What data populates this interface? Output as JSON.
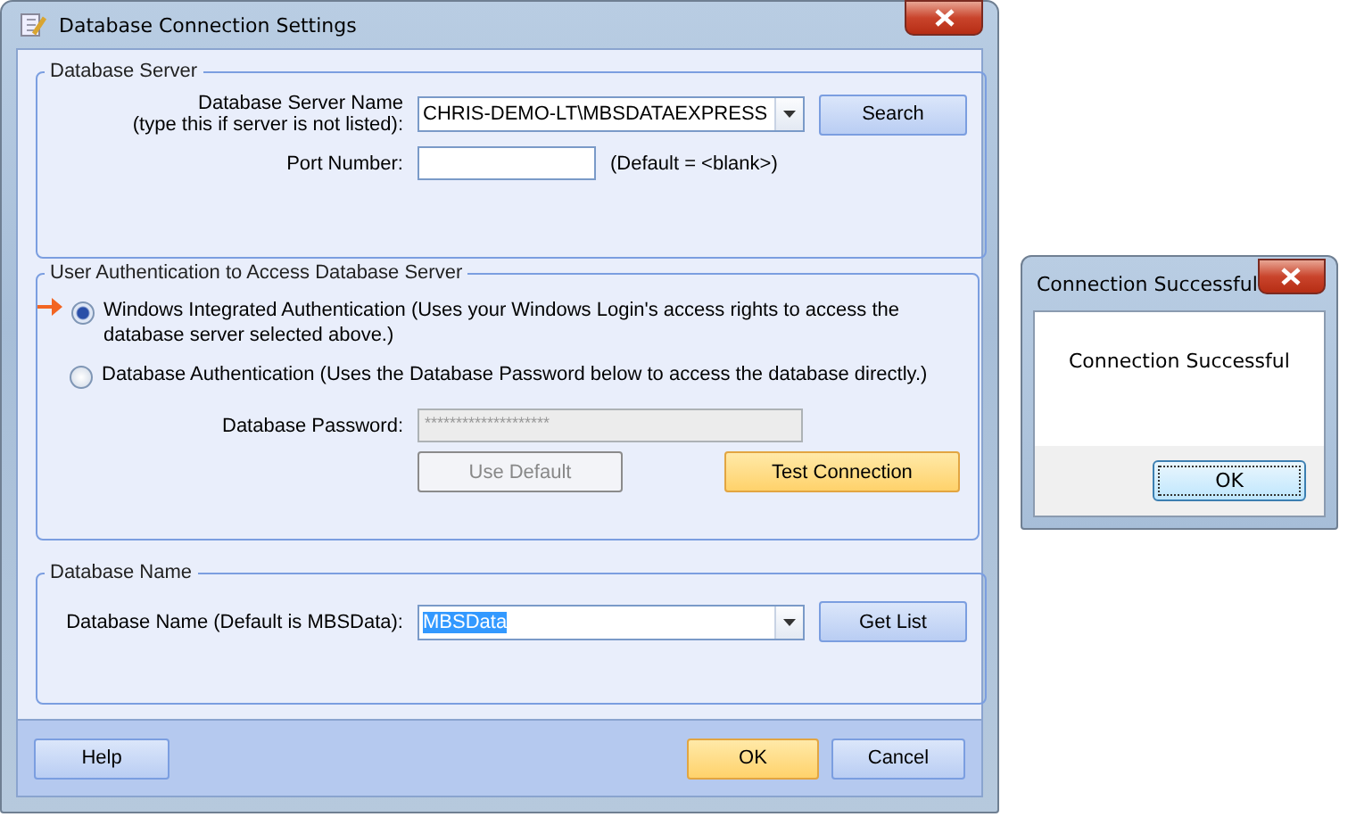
{
  "main_dialog": {
    "title": "Database Connection Settings",
    "server_group": {
      "legend": "Database Server",
      "name_label": "Database Server Name",
      "name_hint": "(type this if server is not listed):",
      "name_value": "CHRIS-DEMO-LT\\MBSDATAEXPRESS",
      "search_button": "Search",
      "port_label": "Port Number:",
      "port_default": "(Default = <blank>)"
    },
    "auth_group": {
      "legend": "User Authentication to Access Database Server",
      "options": [
        {
          "label": "Windows Integrated Authentication (Uses your Windows Login's access rights to access the database server selected above.)",
          "selected": true
        },
        {
          "label": "Database Authentication (Uses the Database Password below to access the database directly.)",
          "selected": false
        }
      ],
      "password_label": "Database Password:",
      "password_value": "********************",
      "password_disabled": true,
      "use_default_button": {
        "label": "Use Default",
        "disabled": true
      },
      "test_button": {
        "label": "Test Connection",
        "hovered": true
      }
    },
    "name_group": {
      "legend": "Database Name",
      "label": "Database Name (Default is MBSData):",
      "value": "MBSData",
      "value_highlighted": true,
      "get_list_button": "Get List"
    },
    "footer": {
      "help_button": "Help",
      "ok_button": "OK",
      "cancel_button": "Cancel"
    }
  },
  "message_box": {
    "title": "Connection Successful",
    "message": "Connection Successful",
    "ok_button": "OK"
  }
}
